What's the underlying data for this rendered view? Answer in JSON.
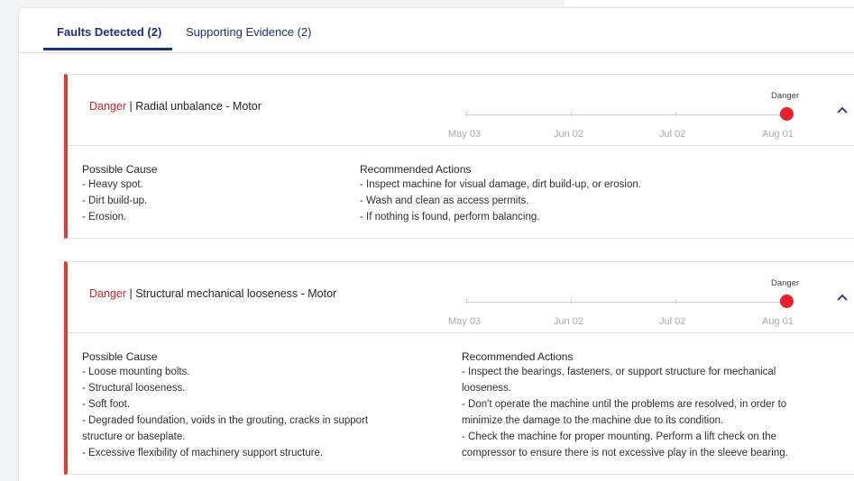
{
  "tabs": [
    {
      "label": "Faults Detected (2)",
      "active": true
    },
    {
      "label": "Supporting Evidence (2)",
      "active": false
    }
  ],
  "colors": {
    "accent": "#1d2d8a",
    "danger": "#e53935"
  },
  "faults": [
    {
      "severity": "Danger",
      "separator": " | ",
      "title": "Radial unbalance - Motor",
      "timeline": {
        "ticks": [
          "May 03",
          "Jun 02",
          "Jul 02",
          "Aug 01"
        ],
        "point_label": "Danger"
      },
      "possible_cause_heading": "Possible Cause",
      "possible_causes": [
        "- Heavy spot.",
        "- Dirt build-up.",
        "- Erosion."
      ],
      "actions_heading": "Recommended Actions",
      "actions": [
        "- Inspect machine for visual damage, dirt build-up, or erosion.",
        "- Wash and clean as access permits.",
        "- If nothing is found, perform balancing."
      ]
    },
    {
      "severity": "Danger",
      "separator": " | ",
      "title": "Structural mechanical looseness - Motor",
      "timeline": {
        "ticks": [
          "May 03",
          "Jun 02",
          "Jul 02",
          "Aug 01"
        ],
        "point_label": "Danger"
      },
      "possible_cause_heading": "Possible Cause",
      "possible_causes": [
        "- Loose mounting bolts.",
        "- Structural looseness.",
        "- Soft foot.",
        "- Degraded foundation, voids in the grouting, cracks in support",
        "structure or baseplate.",
        "- Excessive flexibility of machinery support structure."
      ],
      "actions_heading": "Recommended Actions",
      "actions": [
        "- Inspect the bearings, fasteners, or support structure for mechanical",
        "looseness.",
        "- Don't operate the machine until the problems are resolved, in order to",
        "minimize the damage to the machine due to its condition.",
        "- Check the machine for proper mounting. Perform a lift check on the",
        "compressor to ensure there is not excessive play in the sleeve bearing."
      ]
    }
  ]
}
